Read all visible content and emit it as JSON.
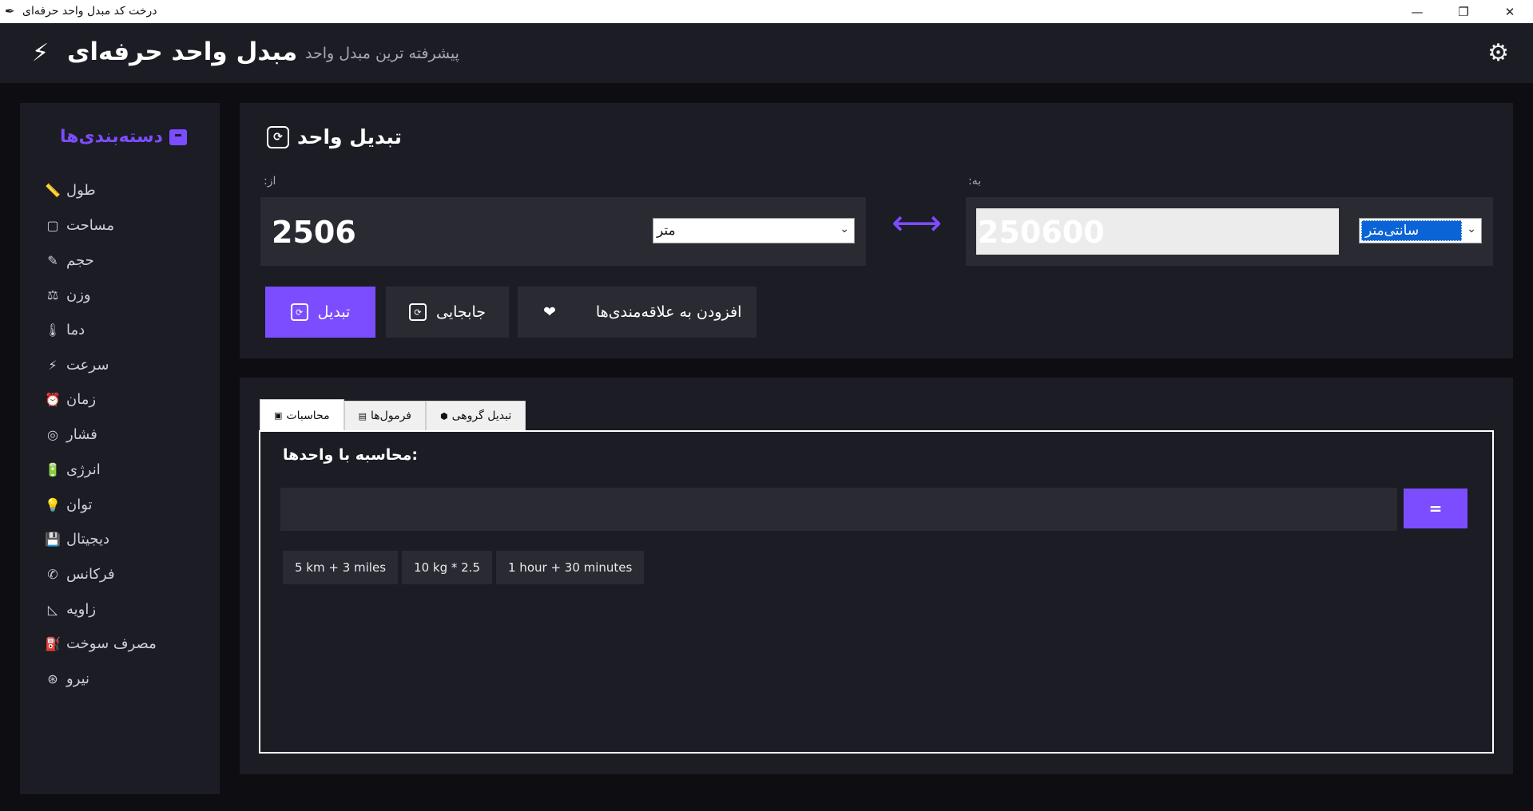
{
  "window": {
    "title": "درخت کد مبدل واحد حرفه‌ای",
    "controls": {
      "minimize": "—",
      "restore": "❐",
      "close": "✕"
    }
  },
  "header": {
    "brand": "مبدل واحد حرفه‌ای",
    "tagline": "پیشرفته ترین مبدل واحد",
    "bolt_icon": "⚡",
    "gear_icon": "⚙"
  },
  "sidebar": {
    "title": "دسته‌بندی‌ها",
    "items": [
      {
        "label": "طول",
        "icon": "📏",
        "icon_name": "ruler-icon"
      },
      {
        "label": "مساحت",
        "icon": "▢",
        "icon_name": "square-icon"
      },
      {
        "label": "حجم",
        "icon": "✎",
        "icon_name": "flask-icon"
      },
      {
        "label": "وزن",
        "icon": "⚖",
        "icon_name": "scale-icon"
      },
      {
        "label": "دما",
        "icon": "🌡",
        "icon_name": "thermometer-icon"
      },
      {
        "label": "سرعت",
        "icon": "⚡",
        "icon_name": "lightning-icon"
      },
      {
        "label": "زمان",
        "icon": "⏰",
        "icon_name": "alarm-clock-icon"
      },
      {
        "label": "فشار",
        "icon": "◎",
        "icon_name": "gauge-icon"
      },
      {
        "label": "انرژی",
        "icon": "🔋",
        "icon_name": "battery-icon"
      },
      {
        "label": "توان",
        "icon": "💡",
        "icon_name": "lightbulb-icon"
      },
      {
        "label": "دیجیتال",
        "icon": "💾",
        "icon_name": "floppy-disk-icon"
      },
      {
        "label": "فرکانس",
        "icon": "✆",
        "icon_name": "satellite-dish-icon"
      },
      {
        "label": "زاویه",
        "icon": "◺",
        "icon_name": "triangle-ruler-icon"
      },
      {
        "label": "مصرف سوخت",
        "icon": "⛽",
        "icon_name": "fuel-pump-icon"
      },
      {
        "label": "نیرو",
        "icon": "⊛",
        "icon_name": "force-icon"
      }
    ]
  },
  "converter": {
    "title": "تبدیل واحد",
    "from_label": ":از",
    "to_label": ":به",
    "from_value": "2506",
    "from_unit": "متر",
    "to_value": "250600",
    "to_unit": "سانتی‌متر",
    "swap_arrow": "⟷",
    "buttons": {
      "convert": "تبدیل",
      "swap": "جابجایی",
      "favorite": "افزودن به علاقه‌مندی‌ها",
      "heart": "❤"
    }
  },
  "tabs": [
    {
      "label": "محاسبات",
      "icon": "▣",
      "active": true
    },
    {
      "label": "فرمول‌ها",
      "icon": "▤",
      "active": false
    },
    {
      "label": "تبدیل گروهی",
      "icon": "⬢",
      "active": false
    }
  ],
  "calculator": {
    "heading": "محاسبه با واحدها:",
    "input_value": "",
    "equals": "=",
    "examples": [
      "5 km + 3 miles",
      "10 kg * 2.5",
      "1 hour + 30 minutes"
    ]
  },
  "colors": {
    "accent": "#7c4dff",
    "background": "#0d0d12",
    "panel": "#1c1c24",
    "field": "#2a2a33",
    "selection": "#0a64d6"
  }
}
